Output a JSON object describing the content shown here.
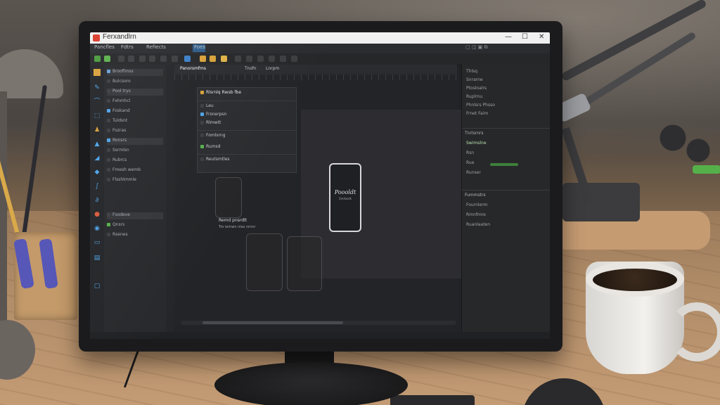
{
  "scene": {
    "colors": {
      "accent_blue": "#4da3e8",
      "accent_green": "#55b04a",
      "logo_red": "#d83b2b"
    }
  },
  "app": {
    "title": "Ferxandlrn",
    "window_controls": [
      "—",
      "☐",
      "✕"
    ]
  },
  "menubar": {
    "items": [
      "Pancfles",
      "Fdtrs",
      "Refiects",
      "Foes"
    ]
  },
  "left_panel": {
    "items": [
      "Brooflmss",
      "Bulcsoro",
      "Pool trys",
      "Fxhmhcl",
      "Foskand",
      "Tuldsnt",
      "Fozras",
      "Ronsrs",
      "Ssrmlsn",
      "Rubrcs",
      "Fmesh wemb",
      "Flsshlmmle",
      "Fsodeve",
      "Qnsrs",
      "Rsenes"
    ]
  },
  "canvas": {
    "tabs": [
      "Panorsmfms",
      "Tnsfn",
      "Lnrpm"
    ],
    "popup_title": "Rlsrnlq Rwsb fbe",
    "popup_rows": [
      "Rlsrnlq Rwsb fbe",
      "Leu",
      "Frsnerpsn",
      "Rlmwtt",
      "Fomlsrng",
      "Rumsd",
      "Reutsmtles"
    ],
    "device_label": "Poooldt",
    "device_sub": "Smrbodk",
    "caption": "Remd pnsrdlt",
    "caption_sub": "Tro iemwn nlas nrnnr"
  },
  "right_panel": {
    "section1_rows": [
      "Thlsq",
      "Snrarne",
      "Ptosloalrs",
      "Ruplrnu",
      "Phnlsrs Phsso",
      "Frnet Faim"
    ],
    "section2_title": "Tnrlsrnrs",
    "section2_rows": [
      "Swimslne",
      "Rsn",
      "Rue",
      "Runser"
    ],
    "section3_title": "Fummstrs",
    "section3_rows": [
      "Fournlerm",
      "Rmnfmre",
      "Ruanlaaten"
    ]
  }
}
